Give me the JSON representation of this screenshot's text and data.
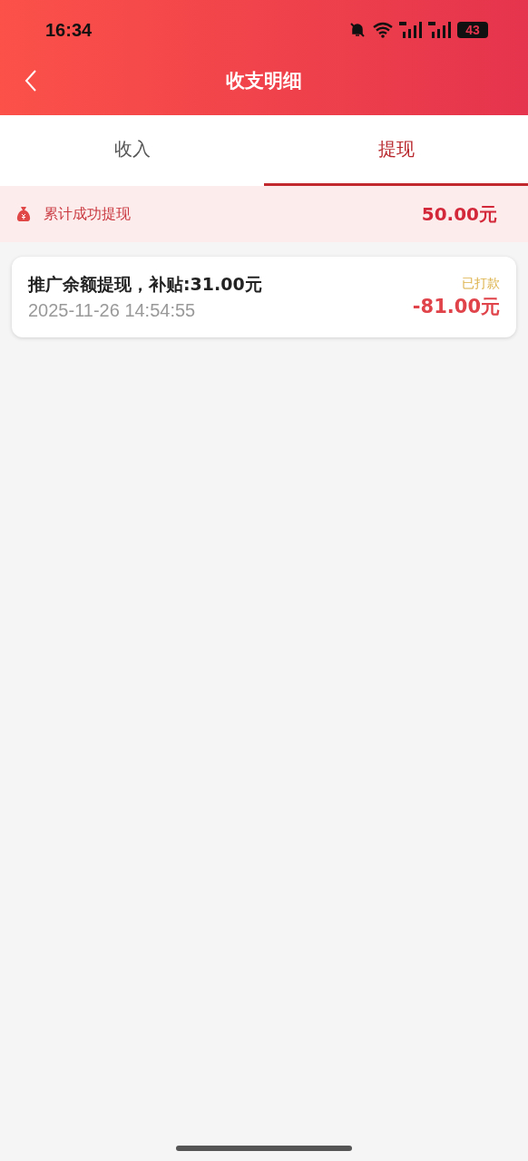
{
  "status_bar": {
    "time": "16:34",
    "battery": "43"
  },
  "header": {
    "title": "收支明细"
  },
  "tabs": [
    {
      "label": "收入",
      "selected": false
    },
    {
      "label": "提现",
      "selected": true
    }
  ],
  "summary": {
    "label": "累计成功提现",
    "amount": "50.00元"
  },
  "records": [
    {
      "title": "推广余额提现，补贴:31.00元",
      "time": "2025-11-26 14:54:55",
      "status": "已打款",
      "amount": "-81.00元"
    }
  ]
}
